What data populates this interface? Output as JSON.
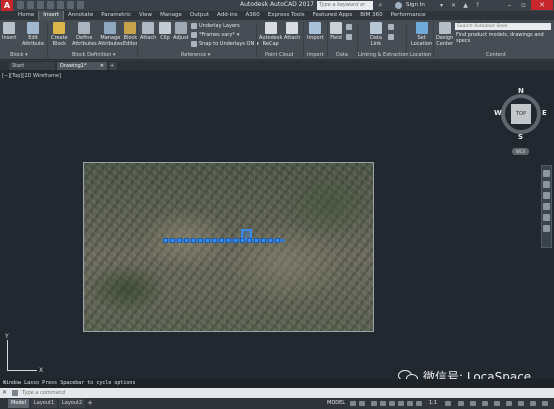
{
  "titlebar": {
    "app_title": "Autodesk AutoCAD 2017",
    "search_placeholder": "Type a keyword or phrase",
    "sign_in": "Sign In",
    "logo_letter": "A"
  },
  "ribbon_tabs": [
    "Home",
    "Insert",
    "Annotate",
    "Parametric",
    "View",
    "Manage",
    "Output",
    "Add-ins",
    "A360",
    "Express Tools",
    "Featured Apps",
    "BIM 360",
    "Performance"
  ],
  "active_ribbon_tab": "Insert",
  "ribbon": {
    "insert": "Insert",
    "edit_attribute": "Edit\nAttribute",
    "create_block": "Create\nBlock",
    "define_attributes": "Define\nAttributes",
    "manage_attributes": "Manage\nAttributes",
    "block_editor": "Block\nEditor",
    "attach": "Attach",
    "clip": "Clip",
    "adjust": "Adjust",
    "underlay_layers": "Underlay Layers",
    "frames_vary": "*Frames vary*",
    "snap_to_underlays": "Snap to Underlays ON",
    "recap": "Autodesk\nReCap",
    "attach_pc": "Attach",
    "import": "Import",
    "field": "Field",
    "data_link": "Data\nLink",
    "set_location": "Set\nLocation",
    "design_center": "Design\nCenter",
    "content_search_placeholder": "Search Autodesk Seek",
    "content_text": "Find product models, drawings and specs"
  },
  "ribbon_panels": {
    "block": "Block",
    "block_definition": "Block Definition",
    "reference": "Reference",
    "point_cloud": "Point Cloud",
    "import": "Import",
    "data": "Data",
    "linking_extraction": "Linking & Extraction",
    "location": "Location",
    "content": "Content"
  },
  "file_tabs": [
    "Start",
    "Drawing1*"
  ],
  "active_file_tab": "Drawing1*",
  "viewport_label": "[−][Top][2D Wireframe]",
  "viewcube": {
    "top": "TOP",
    "north": "N",
    "south": "S",
    "east": "E",
    "west": "W",
    "wcs": "WCS"
  },
  "ucs": {
    "x": "X",
    "y": "Y"
  },
  "command_history": "Window Lasso  Press Spacebar to cycle options",
  "command_placeholder": "Type a command",
  "layout_tabs": [
    "Model",
    "Layout1",
    "Layout2"
  ],
  "active_layout": "Model",
  "status": {
    "model": "MODEL",
    "scale": "1:1"
  },
  "watermark": "微信号: LocaSpace",
  "colors": {
    "accent_blue": "#3a8bf0",
    "app_red": "#c7262c",
    "canvas_bg": "#212830"
  }
}
